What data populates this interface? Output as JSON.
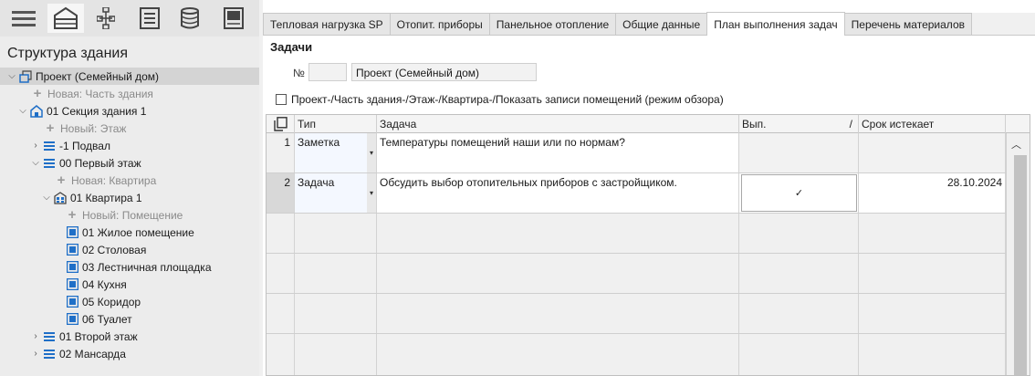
{
  "tree": {
    "title": "Структура здания",
    "nodes": [
      {
        "label": "Проект (Семейный дом)"
      },
      {
        "label": "Новая: Часть здания"
      },
      {
        "label": "01 Секция здания 1"
      },
      {
        "label": "Новый: Этаж"
      },
      {
        "label": "-1 Подвал"
      },
      {
        "label": "00 Первый этаж"
      },
      {
        "label": "Новая: Квартира"
      },
      {
        "label": "01 Квартира 1"
      },
      {
        "label": "Новый: Помещение"
      },
      {
        "label": "01 Жилое помещение"
      },
      {
        "label": "02 Столовая"
      },
      {
        "label": "03 Лестничная площадка"
      },
      {
        "label": "04 Кухня"
      },
      {
        "label": "05 Коридор"
      },
      {
        "label": "06 Туалет"
      },
      {
        "label": "01 Второй этаж"
      },
      {
        "label": "02 Мансарда"
      }
    ]
  },
  "tabs": [
    {
      "label": "Тепловая нагрузка SP"
    },
    {
      "label": "Отопит. приборы"
    },
    {
      "label": "Панельное отопление"
    },
    {
      "label": "Общие данные"
    },
    {
      "label": "План выполнения задач"
    },
    {
      "label": "Перечень материалов"
    }
  ],
  "tasks": {
    "title": "Задачи",
    "number_label": "№",
    "number_value": "",
    "project_value": "Проект (Семейный дом)",
    "show_records_label": "Проект-/Часть здания-/Этаж-/Квартира-/Показать записи помещений (режим обзора)"
  },
  "grid": {
    "headers": {
      "type": "Тип",
      "task": "Задача",
      "done": "Вып.",
      "sort_indicator": "/",
      "due": "Срок истекает"
    },
    "rows": [
      {
        "num": "1",
        "type": "Заметка",
        "task": "Температуры помещений наши или по нормам?",
        "done": "",
        "due": ""
      },
      {
        "num": "2",
        "type": "Задача",
        "task": "Обсудить выбор отопительных приборов с застройщиком.",
        "done": "✓",
        "due": "28.10.2024"
      }
    ]
  },
  "colors": {
    "accent": "#1f6fc7",
    "selected": "#d4d4d4"
  }
}
